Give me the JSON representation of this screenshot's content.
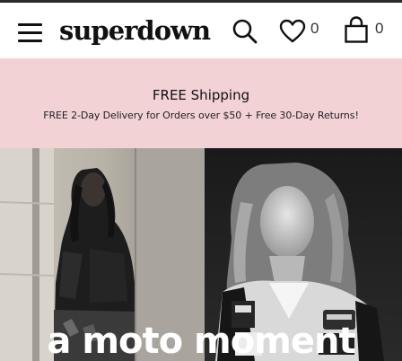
{
  "header": {
    "logo": "superdown",
    "wishlist_count": "0",
    "bag_count": "0",
    "icons": [
      "menu-icon",
      "search-icon",
      "heart-icon",
      "shopping-bag-icon"
    ]
  },
  "promo": {
    "title": "FREE Shipping",
    "subtitle": "FREE 2-Day Delivery for Orders over $50 + Free 30-Day Returns!",
    "background": "#f2d2d5"
  },
  "hero": {
    "title": "a moto moment"
  }
}
